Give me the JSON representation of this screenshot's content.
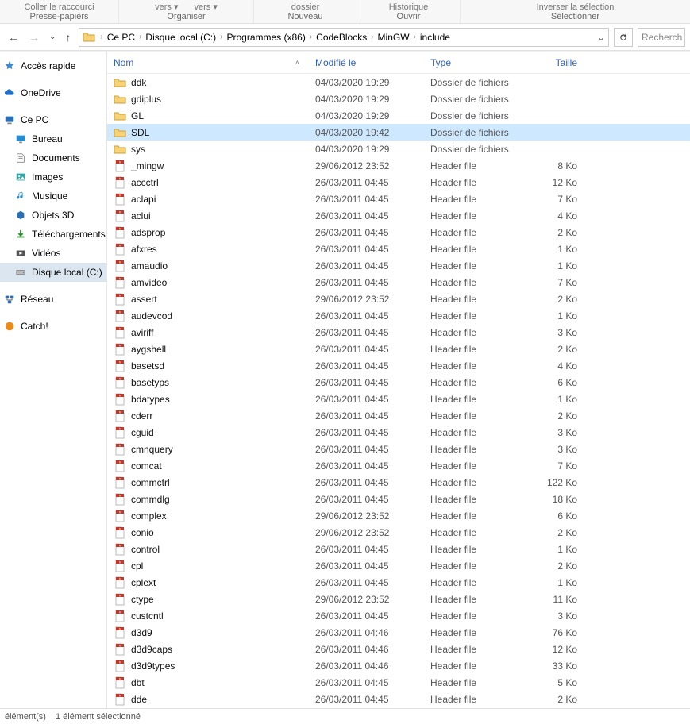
{
  "ribbon": {
    "clipboard_sub": "Coller le raccourci",
    "clipboard_group": "Presse-papiers",
    "move_group_items": [
      "vers ▾",
      "vers ▾"
    ],
    "organize_group": "Organiser",
    "new_group_item": "dossier",
    "new_group": "Nouveau",
    "open_group": "Ouvrir",
    "history_item": "Historique",
    "select_group_item": "Inverser la sélection",
    "select_group": "Sélectionner"
  },
  "nav": {
    "back": "←",
    "forward": "→",
    "dropdown": "⌄",
    "up": "↑"
  },
  "breadcrumb": [
    "Ce PC",
    "Disque local (C:)",
    "Programmes (x86)",
    "CodeBlocks",
    "MinGW",
    "include"
  ],
  "search_placeholder": "Recherch",
  "sidebar": {
    "quick": "Accès rapide",
    "onedrive": "OneDrive",
    "thispc": "Ce PC",
    "desktop": "Bureau",
    "documents": "Documents",
    "pictures": "Images",
    "music": "Musique",
    "objects3d": "Objets 3D",
    "downloads": "Téléchargements",
    "videos": "Vidéos",
    "localdisk": "Disque local (C:)",
    "network": "Réseau",
    "catch": "Catch!"
  },
  "columns": {
    "name": "Nom",
    "modified": "Modifié le",
    "type": "Type",
    "size": "Taille"
  },
  "files": [
    {
      "icon": "folder",
      "name": "ddk",
      "mod": "04/03/2020 19:29",
      "type": "Dossier de fichiers",
      "size": ""
    },
    {
      "icon": "folder",
      "name": "gdiplus",
      "mod": "04/03/2020 19:29",
      "type": "Dossier de fichiers",
      "size": ""
    },
    {
      "icon": "folder",
      "name": "GL",
      "mod": "04/03/2020 19:29",
      "type": "Dossier de fichiers",
      "size": ""
    },
    {
      "icon": "folder",
      "name": "SDL",
      "mod": "04/03/2020 19:42",
      "type": "Dossier de fichiers",
      "size": "",
      "selected": true
    },
    {
      "icon": "folder",
      "name": "sys",
      "mod": "04/03/2020 19:29",
      "type": "Dossier de fichiers",
      "size": ""
    },
    {
      "icon": "hfile",
      "name": "_mingw",
      "mod": "29/06/2012 23:52",
      "type": "Header file",
      "size": "8 Ko"
    },
    {
      "icon": "hfile",
      "name": "accctrl",
      "mod": "26/03/2011 04:45",
      "type": "Header file",
      "size": "12 Ko"
    },
    {
      "icon": "hfile",
      "name": "aclapi",
      "mod": "26/03/2011 04:45",
      "type": "Header file",
      "size": "7 Ko"
    },
    {
      "icon": "hfile",
      "name": "aclui",
      "mod": "26/03/2011 04:45",
      "type": "Header file",
      "size": "4 Ko"
    },
    {
      "icon": "hfile",
      "name": "adsprop",
      "mod": "26/03/2011 04:45",
      "type": "Header file",
      "size": "2 Ko"
    },
    {
      "icon": "hfile",
      "name": "afxres",
      "mod": "26/03/2011 04:45",
      "type": "Header file",
      "size": "1 Ko"
    },
    {
      "icon": "hfile",
      "name": "amaudio",
      "mod": "26/03/2011 04:45",
      "type": "Header file",
      "size": "1 Ko"
    },
    {
      "icon": "hfile",
      "name": "amvideo",
      "mod": "26/03/2011 04:45",
      "type": "Header file",
      "size": "7 Ko"
    },
    {
      "icon": "hfile",
      "name": "assert",
      "mod": "29/06/2012 23:52",
      "type": "Header file",
      "size": "2 Ko"
    },
    {
      "icon": "hfile",
      "name": "audevcod",
      "mod": "26/03/2011 04:45",
      "type": "Header file",
      "size": "1 Ko"
    },
    {
      "icon": "hfile",
      "name": "aviriff",
      "mod": "26/03/2011 04:45",
      "type": "Header file",
      "size": "3 Ko"
    },
    {
      "icon": "hfile",
      "name": "aygshell",
      "mod": "26/03/2011 04:45",
      "type": "Header file",
      "size": "2 Ko"
    },
    {
      "icon": "hfile",
      "name": "basetsd",
      "mod": "26/03/2011 04:45",
      "type": "Header file",
      "size": "4 Ko"
    },
    {
      "icon": "hfile",
      "name": "basetyps",
      "mod": "26/03/2011 04:45",
      "type": "Header file",
      "size": "6 Ko"
    },
    {
      "icon": "hfile",
      "name": "bdatypes",
      "mod": "26/03/2011 04:45",
      "type": "Header file",
      "size": "1 Ko"
    },
    {
      "icon": "hfile",
      "name": "cderr",
      "mod": "26/03/2011 04:45",
      "type": "Header file",
      "size": "2 Ko"
    },
    {
      "icon": "hfile",
      "name": "cguid",
      "mod": "26/03/2011 04:45",
      "type": "Header file",
      "size": "3 Ko"
    },
    {
      "icon": "hfile",
      "name": "cmnquery",
      "mod": "26/03/2011 04:45",
      "type": "Header file",
      "size": "3 Ko"
    },
    {
      "icon": "hfile",
      "name": "comcat",
      "mod": "26/03/2011 04:45",
      "type": "Header file",
      "size": "7 Ko"
    },
    {
      "icon": "hfile",
      "name": "commctrl",
      "mod": "26/03/2011 04:45",
      "type": "Header file",
      "size": "122 Ko"
    },
    {
      "icon": "hfile",
      "name": "commdlg",
      "mod": "26/03/2011 04:45",
      "type": "Header file",
      "size": "18 Ko"
    },
    {
      "icon": "hfile",
      "name": "complex",
      "mod": "29/06/2012 23:52",
      "type": "Header file",
      "size": "6 Ko"
    },
    {
      "icon": "hfile",
      "name": "conio",
      "mod": "29/06/2012 23:52",
      "type": "Header file",
      "size": "2 Ko"
    },
    {
      "icon": "hfile",
      "name": "control",
      "mod": "26/03/2011 04:45",
      "type": "Header file",
      "size": "1 Ko"
    },
    {
      "icon": "hfile",
      "name": "cpl",
      "mod": "26/03/2011 04:45",
      "type": "Header file",
      "size": "2 Ko"
    },
    {
      "icon": "hfile",
      "name": "cplext",
      "mod": "26/03/2011 04:45",
      "type": "Header file",
      "size": "1 Ko"
    },
    {
      "icon": "hfile",
      "name": "ctype",
      "mod": "29/06/2012 23:52",
      "type": "Header file",
      "size": "11 Ko"
    },
    {
      "icon": "hfile",
      "name": "custcntl",
      "mod": "26/03/2011 04:45",
      "type": "Header file",
      "size": "3 Ko"
    },
    {
      "icon": "hfile",
      "name": "d3d9",
      "mod": "26/03/2011 04:46",
      "type": "Header file",
      "size": "76 Ko"
    },
    {
      "icon": "hfile",
      "name": "d3d9caps",
      "mod": "26/03/2011 04:46",
      "type": "Header file",
      "size": "12 Ko"
    },
    {
      "icon": "hfile",
      "name": "d3d9types",
      "mod": "26/03/2011 04:46",
      "type": "Header file",
      "size": "33 Ko"
    },
    {
      "icon": "hfile",
      "name": "dbt",
      "mod": "26/03/2011 04:45",
      "type": "Header file",
      "size": "5 Ko"
    },
    {
      "icon": "hfile",
      "name": "dde",
      "mod": "26/03/2011 04:45",
      "type": "Header file",
      "size": "2 Ko"
    }
  ],
  "status": {
    "count_label": "élément(s)",
    "selection_label": "1 élément sélectionné"
  }
}
